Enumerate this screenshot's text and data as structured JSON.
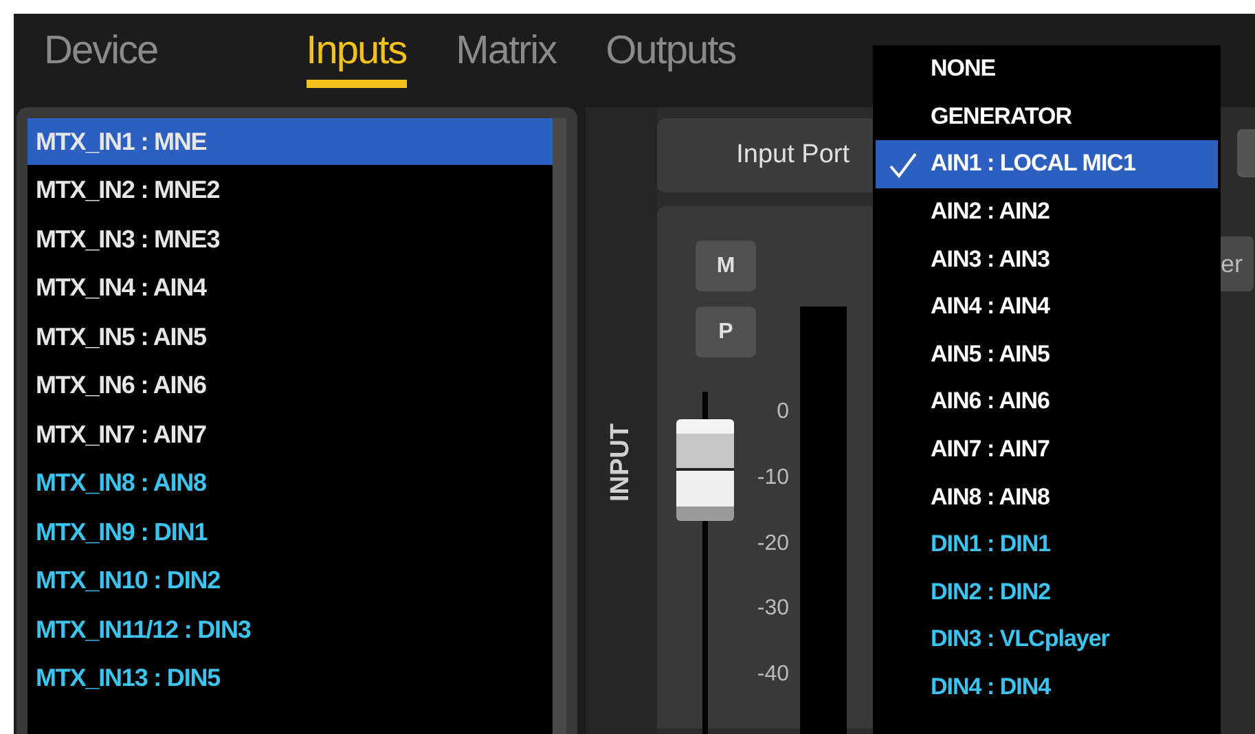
{
  "tabs": [
    {
      "label": "Device",
      "selected": false
    },
    {
      "label": "Inputs",
      "selected": true
    },
    {
      "label": "Matrix",
      "selected": false
    },
    {
      "label": "Outputs",
      "selected": false
    }
  ],
  "input_list": [
    {
      "label": "MTX_IN1 : MNE",
      "selected": true,
      "kind": "analog"
    },
    {
      "label": "MTX_IN2 : MNE2",
      "selected": false,
      "kind": "analog"
    },
    {
      "label": "MTX_IN3 : MNE3",
      "selected": false,
      "kind": "analog"
    },
    {
      "label": "MTX_IN4 : AIN4",
      "selected": false,
      "kind": "analog"
    },
    {
      "label": "MTX_IN5 : AIN5",
      "selected": false,
      "kind": "analog"
    },
    {
      "label": "MTX_IN6 : AIN6",
      "selected": false,
      "kind": "analog"
    },
    {
      "label": "MTX_IN7 : AIN7",
      "selected": false,
      "kind": "analog"
    },
    {
      "label": "MTX_IN8 : AIN8",
      "selected": false,
      "kind": "digital"
    },
    {
      "label": "MTX_IN9 : DIN1",
      "selected": false,
      "kind": "digital"
    },
    {
      "label": "MTX_IN10 : DIN2",
      "selected": false,
      "kind": "digital"
    },
    {
      "label": "MTX_IN11/12 : DIN3",
      "selected": false,
      "kind": "digital"
    },
    {
      "label": "MTX_IN13 : DIN5",
      "selected": false,
      "kind": "digital"
    }
  ],
  "section_label": "INPUT",
  "input_port_label": "Input Port",
  "buttons": [
    "M",
    "P"
  ],
  "fader": {
    "level": 0.9,
    "scale": [
      "0",
      "-10",
      "-20",
      "-30",
      "-40"
    ]
  },
  "side_button": "er",
  "port_menu": [
    {
      "label": "NONE",
      "selected": false,
      "kind": "analog"
    },
    {
      "label": "GENERATOR",
      "selected": false,
      "kind": "analog"
    },
    {
      "label": "AIN1 : LOCAL MIC1",
      "selected": true,
      "kind": "analog"
    },
    {
      "label": "AIN2 : AIN2",
      "selected": false,
      "kind": "analog"
    },
    {
      "label": "AIN3 : AIN3",
      "selected": false,
      "kind": "analog"
    },
    {
      "label": "AIN4 : AIN4",
      "selected": false,
      "kind": "analog"
    },
    {
      "label": "AIN5 : AIN5",
      "selected": false,
      "kind": "analog"
    },
    {
      "label": "AIN6 : AIN6",
      "selected": false,
      "kind": "analog"
    },
    {
      "label": "AIN7 : AIN7",
      "selected": false,
      "kind": "analog"
    },
    {
      "label": "AIN8 : AIN8",
      "selected": false,
      "kind": "analog"
    },
    {
      "label": "DIN1 : DIN1",
      "selected": false,
      "kind": "digital"
    },
    {
      "label": "DIN2 : DIN2",
      "selected": false,
      "kind": "digital"
    },
    {
      "label": "DIN3 : VLCplayer",
      "selected": false,
      "kind": "digital"
    },
    {
      "label": "DIN4 : DIN4",
      "selected": false,
      "kind": "digital"
    }
  ]
}
